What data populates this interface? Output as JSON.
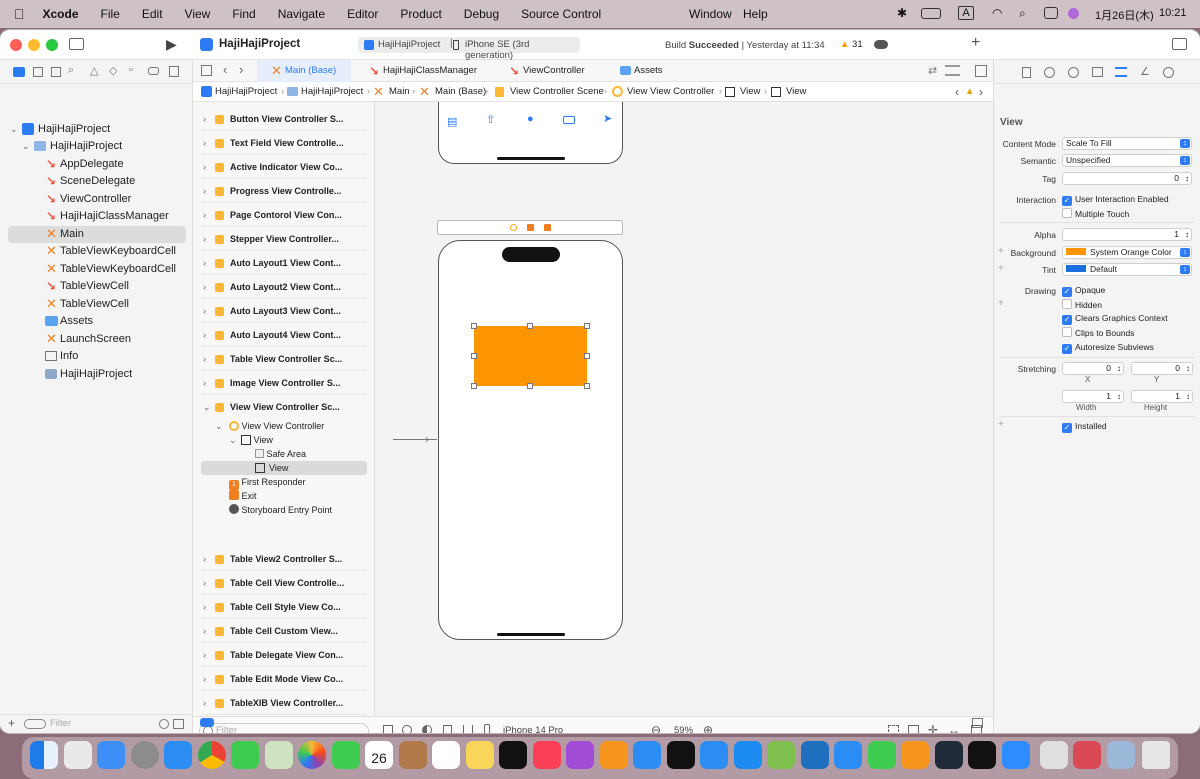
{
  "menubar": {
    "app": "Xcode",
    "items": [
      "File",
      "Edit",
      "View",
      "Find",
      "Navigate",
      "Editor",
      "Product",
      "Debug",
      "Source Control",
      "Window",
      "Help"
    ],
    "datetime": "1月26日(木)",
    "time": "10:21",
    "input_mode": "A"
  },
  "toolbar": {
    "project": "HajiHajiProject",
    "scheme": "HajiHajiProject",
    "device": "iPhone SE (3rd generation)",
    "build_status_prefix": "Build ",
    "build_status": "Succeeded",
    "build_time": "| Yesterday at 11:34",
    "warnings": "31"
  },
  "navigator": {
    "items": [
      {
        "label": "HajiHajiProject",
        "type": "project"
      },
      {
        "label": "HajiHajiProject",
        "type": "folder"
      },
      {
        "label": "AppDelegate",
        "type": "swift"
      },
      {
        "label": "SceneDelegate",
        "type": "swift"
      },
      {
        "label": "ViewController",
        "type": "swift"
      },
      {
        "label": "HajiHajiClassManager",
        "type": "swift"
      },
      {
        "label": "Main",
        "type": "storyboard"
      },
      {
        "label": "TableViewKeyboardCell",
        "type": "xib"
      },
      {
        "label": "TableViewKeyboardCell",
        "type": "xib"
      },
      {
        "label": "TableViewCell",
        "type": "swift"
      },
      {
        "label": "TableViewCell",
        "type": "xib"
      },
      {
        "label": "Assets",
        "type": "assets"
      },
      {
        "label": "LaunchScreen",
        "type": "xib"
      },
      {
        "label": "Info",
        "type": "plist"
      },
      {
        "label": "HajiHajiProject",
        "type": "test"
      }
    ],
    "filter_placeholder": "Filter"
  },
  "tabs": [
    "Main (Base)",
    "HajiHajiClassManager",
    "ViewController",
    "Assets"
  ],
  "jumpbar": [
    "HajiHajiProject",
    "HajiHajiProject",
    "Main",
    "Main (Base)",
    "View Controller Scene",
    "View View Controller",
    "View",
    "View"
  ],
  "outline": {
    "scenes_top": [
      "Button View Controller S...",
      "Text Field View Controlle...",
      "Active Indicator View Co...",
      "Progress View Controlle...",
      "Page Contorol View Con...",
      "Stepper View Controller...",
      "Auto Layout1 View Cont...",
      "Auto Layout2 View Cont...",
      "Auto Layout3 View Cont...",
      "Auto Layout4 View Cont...",
      "Table View Controller Sc...",
      "Image View Controller S..."
    ],
    "expanded": "View View Controller Sc...",
    "children": [
      "View View Controller",
      "View",
      "Safe Area",
      "View",
      "First Responder",
      "Exit",
      "Storyboard Entry Point"
    ],
    "scenes_bottom": [
      "Table View2 Controller S...",
      "Table Cell View Controlle...",
      "Table Cell Style View Co...",
      "Table Cell Custom View...",
      "Table Delegate View Con...",
      "Table Edit Mode View Co...",
      "TableXIB View Controller..."
    ],
    "filter_placeholder": "Filter"
  },
  "bottombar": {
    "device": "iPhone 14 Pro",
    "zoom": "59%"
  },
  "inspector": {
    "title": "View",
    "content_mode_label": "Content Mode",
    "content_mode": "Scale To Fill",
    "semantic_label": "Semantic",
    "semantic": "Unspecified",
    "tag_label": "Tag",
    "tag": "0",
    "interaction_label": "Interaction",
    "user_interaction": "User Interaction Enabled",
    "multiple_touch": "Multiple Touch",
    "alpha_label": "Alpha",
    "alpha": "1",
    "background_label": "Background",
    "background": "System Orange Color",
    "tint_label": "Tint",
    "tint": "Default",
    "drawing_label": "Drawing",
    "opaque": "Opaque",
    "hidden": "Hidden",
    "clears": "Clears Graphics Context",
    "clips": "Clips to Bounds",
    "autoresize": "Autoresize Subviews",
    "stretching_label": "Stretching",
    "stretch_x": "0",
    "stretch_y": "0",
    "x_label": "X",
    "y_label": "Y",
    "stretch_w": "1",
    "stretch_h": "1",
    "width_label": "Width",
    "height_label": "Height",
    "installed": "Installed"
  },
  "colors": {
    "orange": "#ff9500",
    "accent": "#2d7cf6",
    "tint_blue": "#1a6fe0"
  },
  "calendar_day": "26"
}
